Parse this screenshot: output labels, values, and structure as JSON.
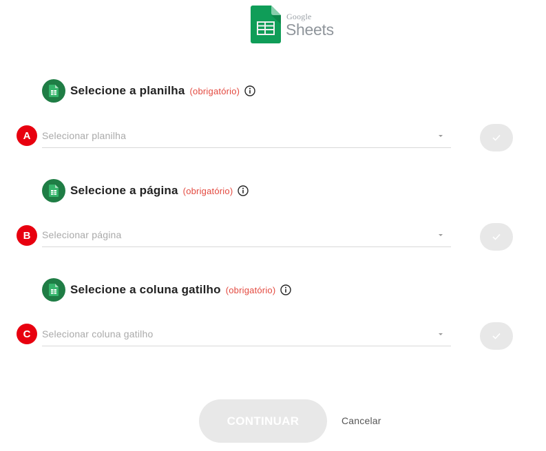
{
  "logo": {
    "google": "Google",
    "product": "Sheets",
    "icon": "google-sheets-icon",
    "color": "#0f9d58"
  },
  "sections": [
    {
      "marker": "A",
      "title": "Selecione a planilha",
      "required": "(obrigatório)",
      "placeholder": "Selecionar planilha",
      "icon": "spreadsheet-icon",
      "info_icon": "info-icon",
      "confirm_icon": "check-icon"
    },
    {
      "marker": "B",
      "title": "Selecione a página",
      "required": "(obrigatório)",
      "placeholder": "Selecionar página",
      "icon": "spreadsheet-icon",
      "info_icon": "info-icon",
      "confirm_icon": "check-icon"
    },
    {
      "marker": "C",
      "title": "Selecione a coluna gatilho",
      "required": "(obrigatório)",
      "placeholder": "Selecionar coluna gatilho",
      "icon": "spreadsheet-icon",
      "info_icon": "info-icon",
      "confirm_icon": "check-icon"
    }
  ],
  "footer": {
    "continue_label": "CONTINUAR",
    "cancel_label": "Cancelar"
  },
  "colors": {
    "accent_green": "#1f7d45",
    "required_red": "#e3493f",
    "marker_red": "#e8000f",
    "disabled_gray": "#e8e8e8"
  }
}
